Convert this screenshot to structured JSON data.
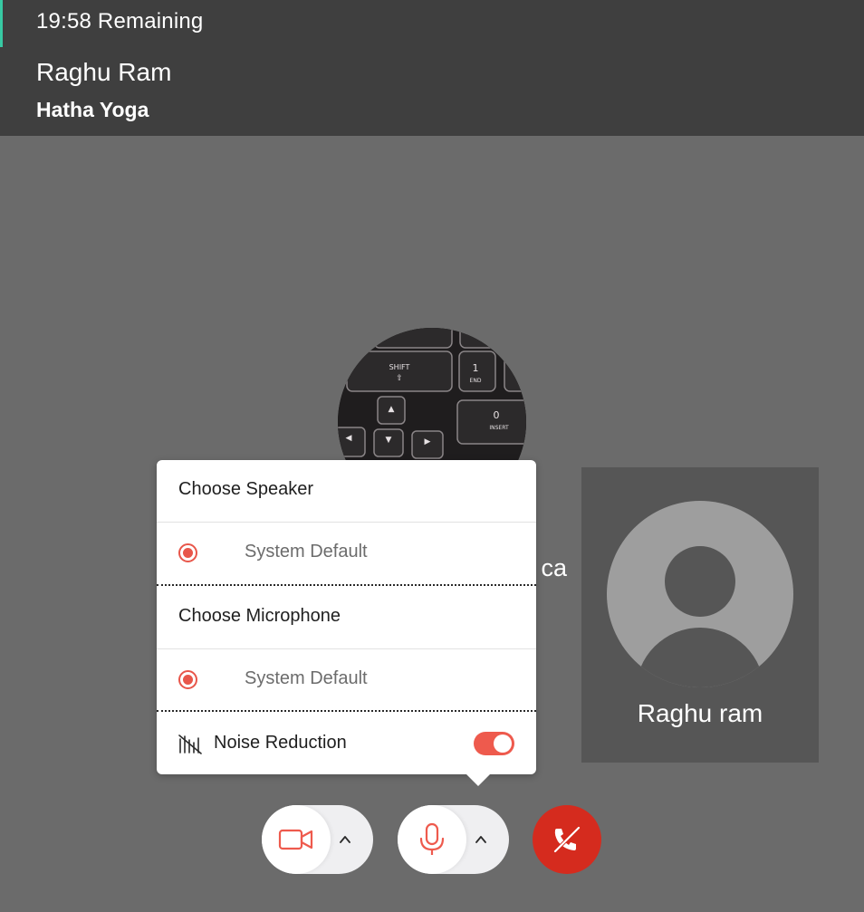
{
  "header": {
    "timer": "19:58 Remaining",
    "host_name": "Raghu Ram",
    "session_name": "Hatha Yoga"
  },
  "stage": {
    "waiting_text_partial": "eir ca"
  },
  "participant": {
    "name": "Raghu ram",
    "avatar_icon": "user-avatar-icon"
  },
  "device_popup": {
    "speaker_title": "Choose Speaker",
    "speaker_option": "System Default",
    "microphone_title": "Choose Microphone",
    "microphone_option": "System Default",
    "noise_reduction_label": "Noise Reduction",
    "noise_reduction_enabled": true
  },
  "controls": {
    "camera_icon": "video-camera-icon",
    "mic_icon": "microphone-icon",
    "end_call_icon": "end-call-icon",
    "chevron_icon": "chevron-up-icon"
  },
  "colors": {
    "accent": "#ee5a4d",
    "end_call": "#d52b1e",
    "header_bg": "#3f3f3f",
    "stage_bg": "#6b6b6b",
    "timer_accent": "#37c9a3"
  }
}
